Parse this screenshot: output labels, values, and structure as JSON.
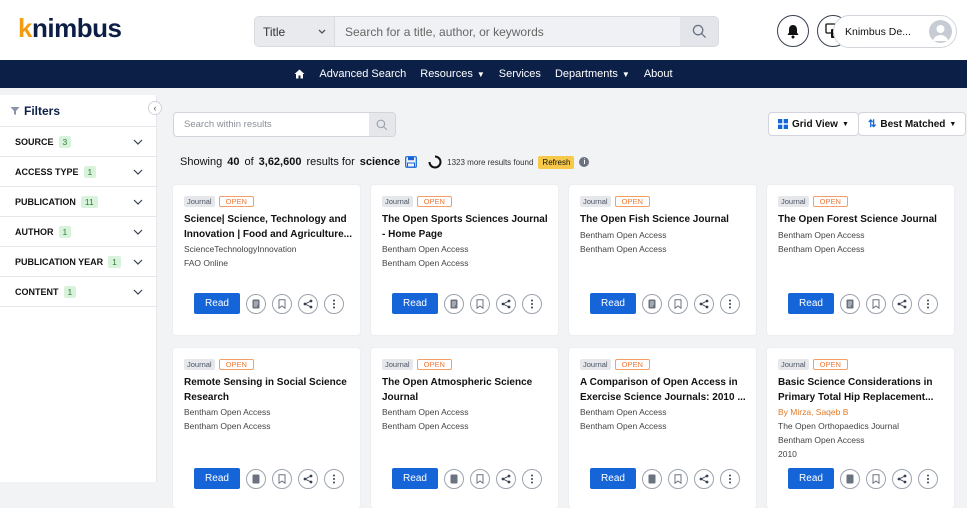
{
  "brand": {
    "logo_k": "k",
    "logo_rest": "nimbus"
  },
  "search": {
    "field_option": "Title",
    "placeholder": "Search for a title, author, or keywords"
  },
  "user": {
    "name": "Knimbus De..."
  },
  "nav": {
    "items": [
      "Advanced Search",
      "Resources",
      "Services",
      "Departments",
      "About"
    ]
  },
  "filters": {
    "title": "Filters",
    "rows": [
      {
        "label": "SOURCE",
        "count": "3"
      },
      {
        "label": "ACCESS TYPE",
        "count": "1"
      },
      {
        "label": "PUBLICATION",
        "count": "11"
      },
      {
        "label": "AUTHOR",
        "count": "1"
      },
      {
        "label": "PUBLICATION YEAR",
        "count": "1"
      },
      {
        "label": "CONTENT",
        "count": "1"
      }
    ]
  },
  "results": {
    "search_placeholder": "Search within results",
    "view_label": "Grid View",
    "sort_label": "Best Matched",
    "showing_prefix": "Showing",
    "shown": "40",
    "of": "of",
    "total": "3,62,600",
    "results_for": "results for",
    "query": "science",
    "more_found": "1323 more results found",
    "refresh": "Refresh"
  },
  "card_common": {
    "type": "Journal",
    "access": "OPEN",
    "read": "Read"
  },
  "cards": [
    {
      "title": "Science| Science, Technology and Innovation | Food and Agriculture...",
      "meta": [
        "ScienceTechnologyInnovation",
        "FAO Online"
      ]
    },
    {
      "title": "The Open Sports Sciences Journal - Home Page",
      "meta": [
        "Bentham Open Access",
        "Bentham Open Access"
      ]
    },
    {
      "title": "The Open Fish Science Journal",
      "meta": [
        "Bentham Open Access",
        "Bentham Open Access"
      ]
    },
    {
      "title": "The Open Forest Science Journal",
      "meta": [
        "Bentham Open Access",
        "Bentham Open Access"
      ]
    },
    {
      "title": "Remote Sensing in Social Science Research",
      "meta": [
        "Bentham Open Access",
        "Bentham Open Access"
      ]
    },
    {
      "title": "The Open Atmospheric Science Journal",
      "meta": [
        "Bentham Open Access",
        "Bentham Open Access"
      ]
    },
    {
      "title": "A Comparison of Open Access in Exercise Science Journals: 2010 ...",
      "meta": [
        "Bentham Open Access",
        "Bentham Open Access"
      ]
    },
    {
      "title": "Basic Science Considerations in Primary Total Hip Replacement...",
      "author": "By Mirza, Saqeb B",
      "meta": [
        "The Open Orthopaedics Journal",
        "Bentham Open Access",
        "2010"
      ]
    }
  ],
  "colors": {
    "navy": "#0c1f47",
    "accent": "#f39c12",
    "read_button": "#1565d8",
    "open_tag": "#f07b3a"
  }
}
